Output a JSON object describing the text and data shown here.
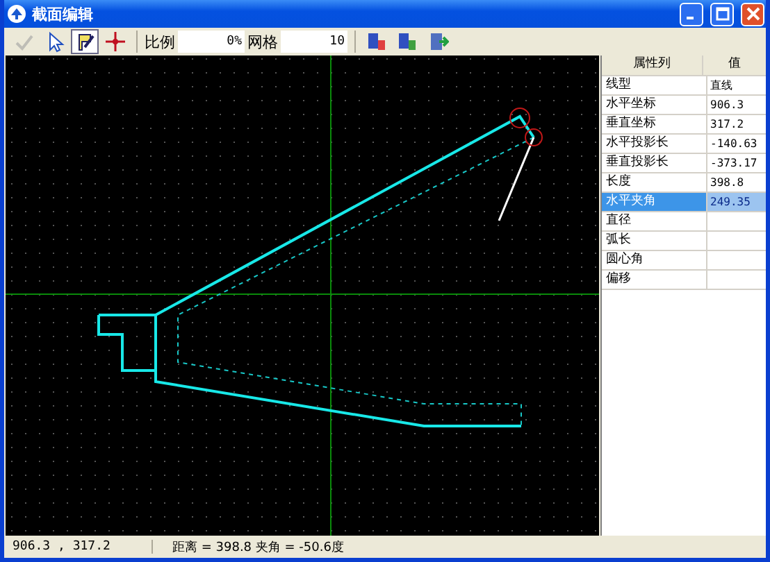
{
  "window": {
    "title": "截面编辑"
  },
  "toolbar": [
    {
      "kind": "tool",
      "disabled": true,
      "selected": false
    },
    {
      "kind": "tool",
      "disabled": false,
      "selected": false
    },
    {
      "kind": "tool",
      "disabled": false,
      "selected": true
    },
    {
      "kind": "tool",
      "disabled": false,
      "selected": false
    },
    {
      "kind": "field",
      "label": "比例",
      "value": "0%"
    },
    {
      "kind": "field",
      "label": "网格",
      "value": "10"
    },
    {
      "kind": "tool",
      "disabled": false,
      "selected": false
    },
    {
      "kind": "tool",
      "disabled": false,
      "selected": false
    },
    {
      "kind": "tool",
      "disabled": false,
      "selected": false
    }
  ],
  "properties": {
    "columns": [
      "属性列",
      "值"
    ],
    "rows": [
      {
        "name": "线型",
        "value": "直线",
        "selected": false
      },
      {
        "name": "水平坐标",
        "value": "906.3",
        "selected": false
      },
      {
        "name": "垂直坐标",
        "value": "317.2",
        "selected": false
      },
      {
        "name": "水平投影长",
        "value": "-140.63",
        "selected": false
      },
      {
        "name": "垂直投影长",
        "value": "-373.17",
        "selected": false
      },
      {
        "name": "长度",
        "value": "398.8",
        "selected": false
      },
      {
        "name": "水平夹角",
        "value": "249.35",
        "selected": true
      },
      {
        "name": "直径",
        "selected": false
      },
      {
        "name": "弧长",
        "selected": false
      },
      {
        "name": "圆心角",
        "selected": false
      },
      {
        "name": "偏移",
        "selected": false
      }
    ]
  },
  "status_bar": {
    "coordinates": "906.3 , 317.2",
    "measure": "距离 = 398.8 夹角 = -50.6度"
  }
}
